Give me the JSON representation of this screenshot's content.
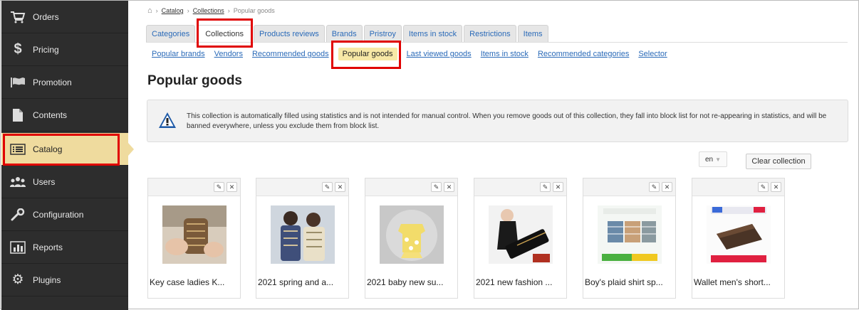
{
  "sidebar": {
    "items": [
      {
        "label": "Orders",
        "icon": "cart-icon"
      },
      {
        "label": "Pricing",
        "icon": "dollar-icon"
      },
      {
        "label": "Promotion",
        "icon": "flag-icon"
      },
      {
        "label": "Contents",
        "icon": "document-icon"
      },
      {
        "label": "Catalog",
        "icon": "list-icon"
      },
      {
        "label": "Users",
        "icon": "users-icon"
      },
      {
        "label": "Configuration",
        "icon": "wrench-icon"
      },
      {
        "label": "Reports",
        "icon": "bar-chart-icon"
      },
      {
        "label": "Plugins",
        "icon": "gear-icon"
      }
    ],
    "active": "Catalog",
    "active_color": "#efdb9e"
  },
  "breadcrumb": {
    "home_icon": "home-icon",
    "items": [
      "Catalog",
      "Collections",
      "Popular goods"
    ]
  },
  "tabs": [
    "Categories",
    "Collections",
    "Products reviews",
    "Brands",
    "Pristroy",
    "Items in stock",
    "Restrictions",
    "Items"
  ],
  "active_tab": "Collections",
  "subtabs": [
    "Popular brands",
    "Vendors",
    "Recommended goods",
    "Popular goods",
    "Last viewed goods",
    "Items in stock",
    "Recommended categories",
    "Selector"
  ],
  "active_subtab": "Popular goods",
  "page_title": "Popular goods",
  "notice": {
    "icon": "warning-icon",
    "text": "This collection is automatically filled using statistics and is not intended for manual control. When you remove goods out of this collection, they fall into block list for not re-appearing in statistics, and will be banned everywhere, unless you exclude them from block list."
  },
  "language_select": {
    "value": "en"
  },
  "clear_button": "Clear collection",
  "products": [
    {
      "name": "Key case ladies K..."
    },
    {
      "name": "2021 spring and a..."
    },
    {
      "name": "2021 baby new su..."
    },
    {
      "name": "2021 new fashion ..."
    },
    {
      "name": "Boy's plaid shirt sp..."
    },
    {
      "name": "Wallet men's short..."
    }
  ],
  "card_actions": {
    "edit_icon": "pencil-icon",
    "remove_icon": "close-icon"
  },
  "highlight_color": "#e00000"
}
